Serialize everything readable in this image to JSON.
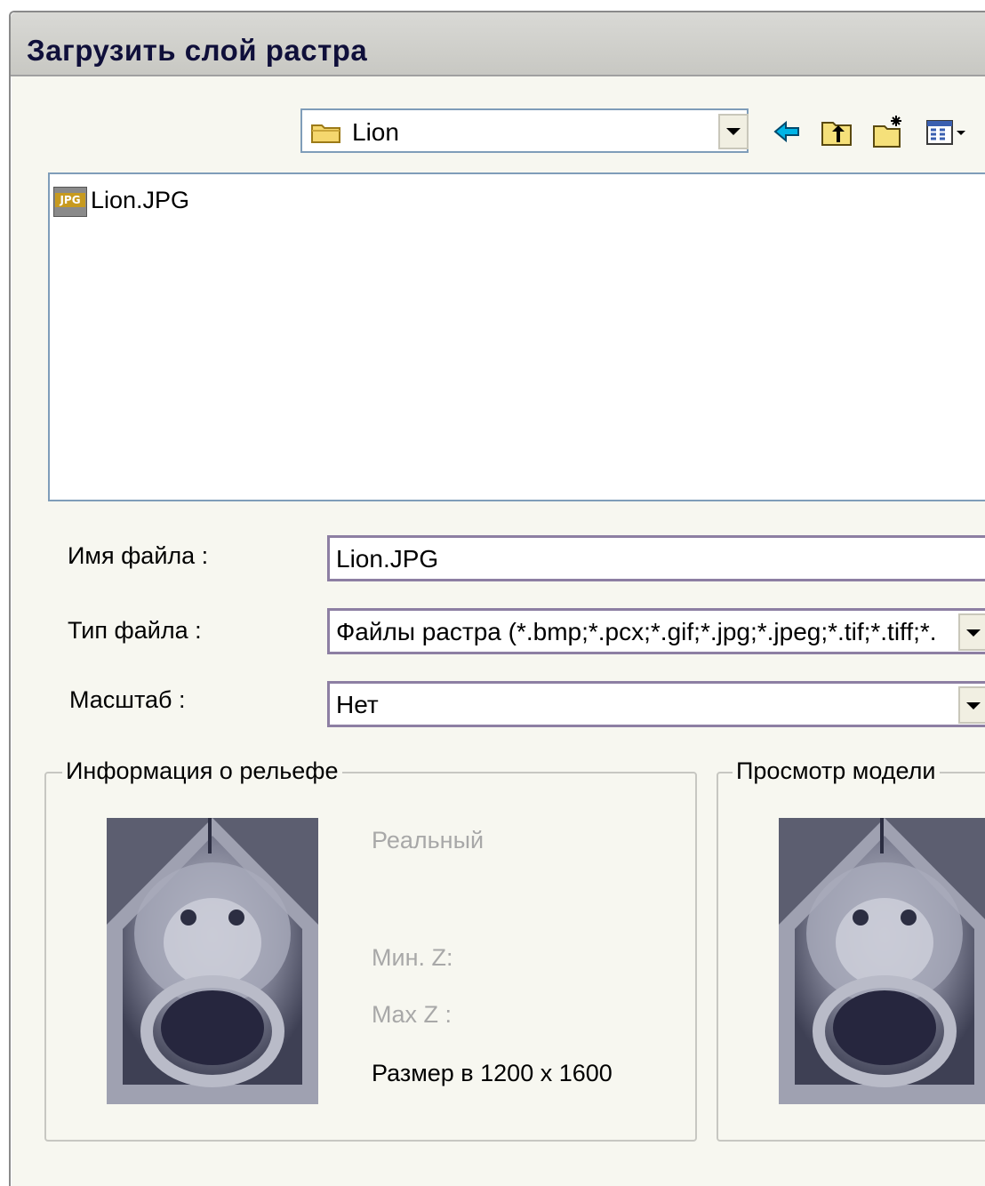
{
  "window": {
    "title": "Загрузить слой растра"
  },
  "look_in": {
    "value": "Lion",
    "icon": "folder-icon"
  },
  "toolbar": {
    "icons": [
      "back-arrow-icon",
      "up-folder-icon",
      "new-folder-icon",
      "view-menu-icon"
    ]
  },
  "file_list": {
    "items": [
      {
        "name": "Lion.JPG",
        "icon": "jpg-file-icon"
      }
    ]
  },
  "form": {
    "filename_label": "Имя файла :",
    "filename_value": "Lion.JPG",
    "filetype_label": "Тип файла :",
    "filetype_value": "Файлы растра (*.bmp;*.pcx;*.gif;*.jpg;*.jpeg;*.tif;*.tiff;*.",
    "scale_label": "Масштаб :",
    "scale_value": "Нет"
  },
  "relief_info": {
    "title": "Информация о рельефе",
    "real_label": "Реальный",
    "min_z_label": "Мин. Z:",
    "max_z_label": "Max Z :",
    "size_text": "Размер в 1200 x 1600"
  },
  "model_preview": {
    "title": "Просмотр модели"
  },
  "colors": {
    "accent_border": "#7f9db9",
    "field_border": "#8d7fa3",
    "disabled_text": "#a8a8a8"
  }
}
